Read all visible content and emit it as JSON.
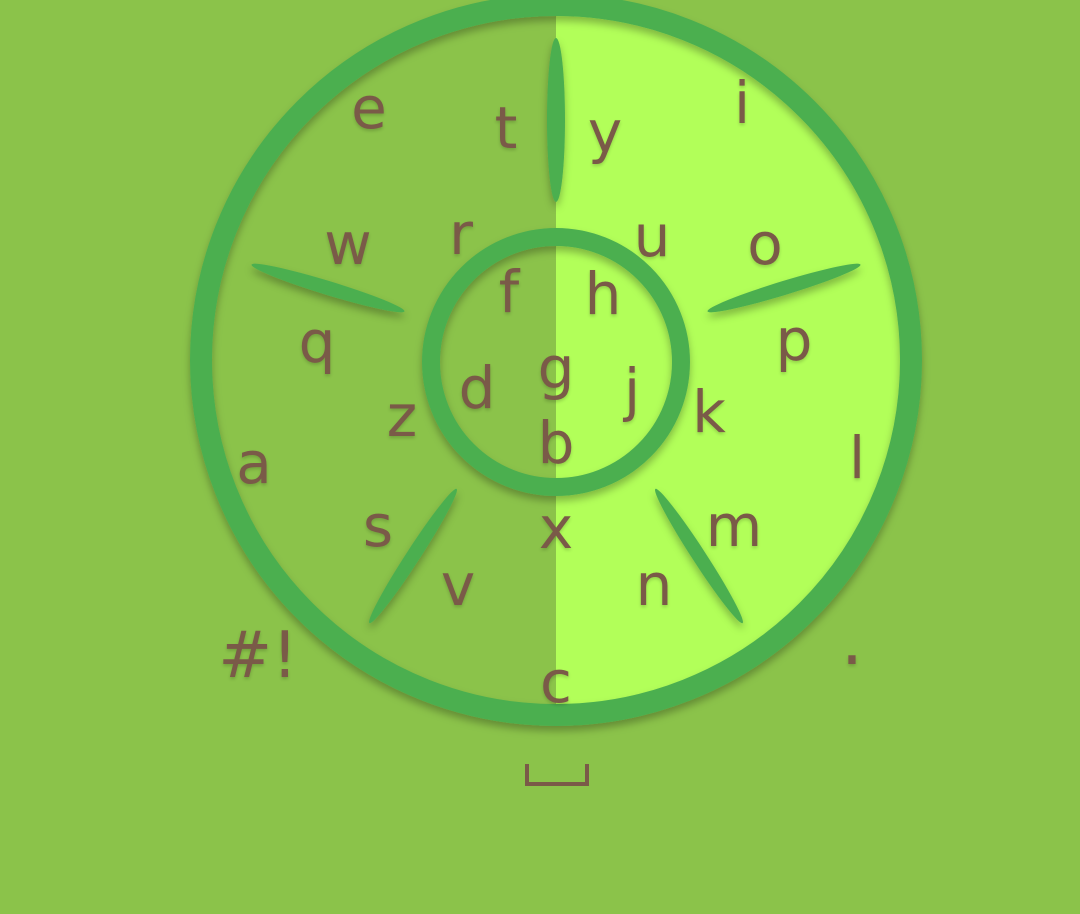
{
  "colors": {
    "background": "#8bc34a",
    "dial_left_half": "#8bc34a",
    "dial_right_half": "#b2ff59",
    "ring_stroke": "#4caf50",
    "key_text": "#7a5a48"
  },
  "keyboard": {
    "keys": {
      "e": "e",
      "t": "t",
      "y": "y",
      "i": "i",
      "w": "w",
      "r": "r",
      "u": "u",
      "o": "o",
      "f": "f",
      "h": "h",
      "q": "q",
      "p": "p",
      "g": "g",
      "d": "d",
      "j": "j",
      "z": "z",
      "k": "k",
      "b": "b",
      "a": "a",
      "l": "l",
      "s": "s",
      "x": "x",
      "m": "m",
      "v": "v",
      "n": "n",
      "c": "c"
    },
    "symbols_key": "#!",
    "period_key": ".",
    "space_icon": "space-bar-icon"
  }
}
